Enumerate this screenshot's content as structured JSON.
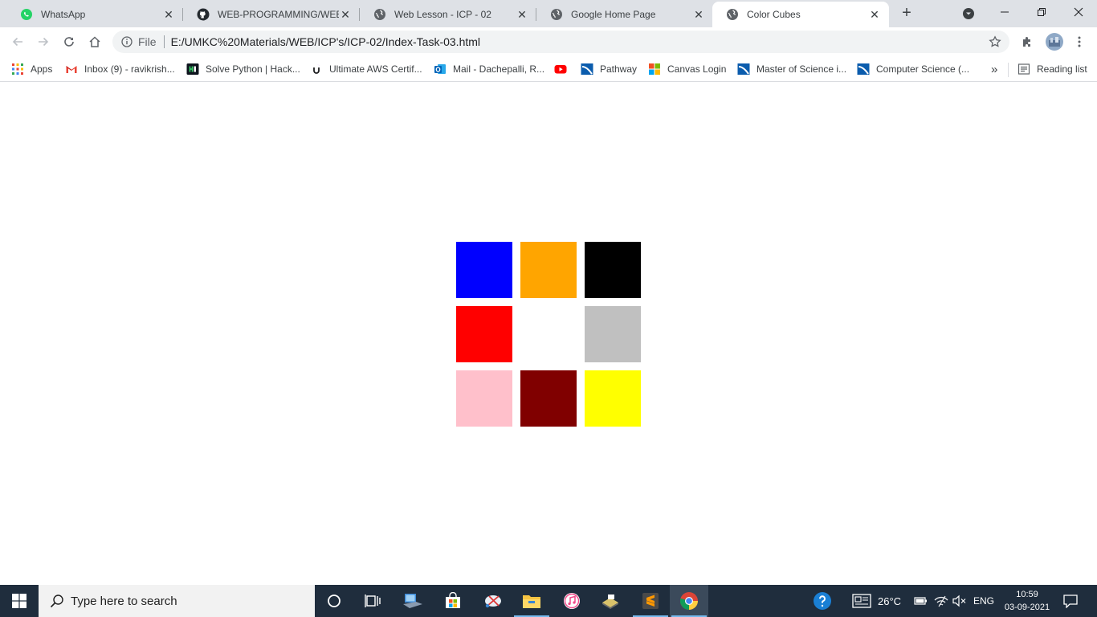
{
  "browser": {
    "tabs": [
      {
        "title": "WhatsApp",
        "icon": "whatsapp-icon"
      },
      {
        "title": "WEB-PROGRAMMING/WEB-2",
        "icon": "github-icon"
      },
      {
        "title": "Web Lesson - ICP - 02",
        "icon": "globe-icon"
      },
      {
        "title": "Google Home Page",
        "icon": "globe-icon"
      },
      {
        "title": "Color Cubes",
        "icon": "globe-icon",
        "active": true
      }
    ],
    "close_glyph": "✕",
    "new_tab_glyph": "+",
    "window_controls": {
      "minimize": "—",
      "maximize": "❐",
      "close": "✕"
    }
  },
  "toolbar": {
    "scheme_label": "File",
    "url": "E:/UMKC%20Materials/WEB/ICP's/ICP-02/Index-Task-03.html"
  },
  "bookmarks": {
    "items": [
      {
        "label": "Apps",
        "icon": "apps-grid-icon"
      },
      {
        "label": "Inbox (9) - ravikrish...",
        "icon": "gmail-icon"
      },
      {
        "label": "Solve Python | Hack...",
        "icon": "hackerrank-icon"
      },
      {
        "label": "Ultimate AWS Certif...",
        "icon": "udemy-icon"
      },
      {
        "label": "Mail - Dachepalli, R...",
        "icon": "outlook-icon"
      },
      {
        "label": "",
        "icon": "youtube-icon"
      },
      {
        "label": "Pathway",
        "icon": "pathway-icon"
      },
      {
        "label": "Canvas Login",
        "icon": "microsoft-icon"
      },
      {
        "label": "Master of Science i...",
        "icon": "pathway-icon"
      },
      {
        "label": "Computer Science (...",
        "icon": "pathway-icon"
      }
    ],
    "overflow_glyph": "»",
    "reading_list_label": "Reading list"
  },
  "page": {
    "cubes": [
      {
        "color": "#0000ff"
      },
      {
        "color": "#ffa500"
      },
      {
        "color": "#000000"
      },
      {
        "color": "#ff0000"
      },
      {
        "color": "#ffffff"
      },
      {
        "color": "#c0c0c0"
      },
      {
        "color": "#ffc0cb"
      },
      {
        "color": "#800000"
      },
      {
        "color": "#ffff00"
      }
    ]
  },
  "taskbar": {
    "search_placeholder": "Type here to search",
    "weather": "26°C",
    "language": "ENG",
    "time": "10:59",
    "date": "03-09-2021"
  }
}
